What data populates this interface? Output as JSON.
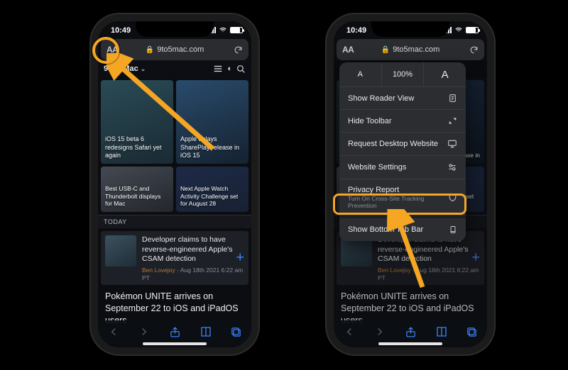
{
  "status": {
    "time": "10:49"
  },
  "address_bar": {
    "aa_label": "AA",
    "domain": "9to5mac.com"
  },
  "site_bar": {
    "logo_prefix": "9T",
    "logo_circle": "O",
    "logo_suffix": "5Mac",
    "chevron": "⌄"
  },
  "tiles_row1": [
    {
      "caption": "iOS 15 beta 6 redesigns Safari yet again"
    },
    {
      "caption": "Apple delays SharePlay release in iOS 15"
    }
  ],
  "tiles_row2": [
    {
      "caption": "Best USB-C and Thunderbolt displays for Mac"
    },
    {
      "caption": "Next Apple Watch Activity Challenge set for August 28"
    }
  ],
  "today_label": "TODAY",
  "card": {
    "title": "Developer claims to have reverse-engineered Apple's CSAM detection",
    "author": "Ben Lovejoy",
    "meta_sep": " - ",
    "timestamp": "Aug 18th 2021 6:22 am PT",
    "plus": "+"
  },
  "headline": "Pokémon UNITE arrives on September 22 to iOS and iPadOS users",
  "aa_menu": {
    "smallA": "A",
    "zoom_pct": "100%",
    "bigA": "A",
    "items": [
      {
        "label": "Show Reader View",
        "icon": "reader-icon"
      },
      {
        "label": "Hide Toolbar",
        "icon": "expand-icon"
      },
      {
        "label": "Request Desktop Website",
        "icon": "desktop-icon"
      },
      {
        "label": "Website Settings",
        "icon": "settings-toggle-icon"
      },
      {
        "label": "Privacy Report",
        "sub": "Turn On Cross-Site Tracking Prevention",
        "icon": "shield-icon"
      },
      {
        "label": "Show Bottom Tab Bar",
        "icon": "tab-bar-icon"
      }
    ]
  },
  "right_tiles_row2_visible": [
    {
      "caption": "Best USB-C and Thunderbolt displays for Mac"
    },
    {
      "caption": "Next Apple Watch Activity Challenge set for August 28"
    }
  ],
  "annotation": {
    "accent": "#f5a623"
  }
}
